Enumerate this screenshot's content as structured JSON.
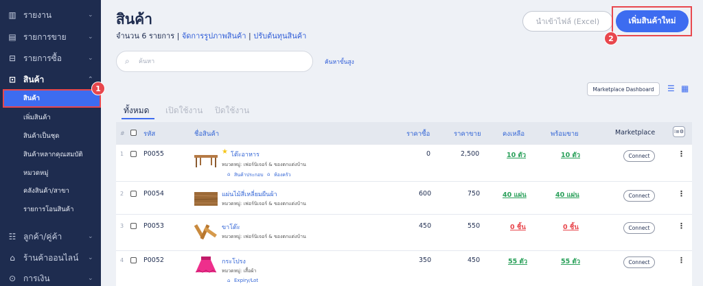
{
  "sidebar": {
    "items_top": [
      {
        "label": "รายงาน",
        "icon": "bar-chart-icon"
      },
      {
        "label": "รายการขาย",
        "icon": "clipboard-icon"
      },
      {
        "label": "รายการซื้อ",
        "icon": "cart-icon"
      },
      {
        "label": "สินค้า",
        "icon": "box-icon"
      }
    ],
    "sub_items": [
      {
        "label": "สินค้า"
      },
      {
        "label": "เพิ่มสินค้า"
      },
      {
        "label": "สินค้าเป็นชุด"
      },
      {
        "label": "สินค้าหลากคุณสมบัติ"
      },
      {
        "label": "หมวดหมู่"
      },
      {
        "label": "คลังสินค้า/สาขา"
      },
      {
        "label": "รายการโอนสินค้า"
      }
    ],
    "items_bottom": [
      {
        "label": "ลูกค้า/คู่ค้า",
        "icon": "people-icon"
      },
      {
        "label": "ร้านค้าออนไลน์",
        "icon": "store-icon"
      },
      {
        "label": "การเงิน",
        "icon": "money-icon"
      }
    ],
    "badge": "1"
  },
  "header": {
    "title": "สินค้า",
    "count_text": "จำนวน 6 รายการ",
    "sep": "|",
    "manage_images_link": "จัดการรูปภาพสินค้า",
    "adjust_cost_link": "ปรับต้นทุนสินค้า",
    "import_button": "นำเข้าไฟล์ (Excel)",
    "add_button": "เพิ่มสินค้าใหม่",
    "badge": "2"
  },
  "search": {
    "placeholder": "ค้นหา",
    "advanced_link": "ค้นหาขั้นสูง"
  },
  "toolbar": {
    "marketplace_dashboard": "Marketplace Dashboard"
  },
  "tabs": [
    {
      "label": "ทั้งหมด",
      "active": true
    },
    {
      "label": "เปิดใช้งาน",
      "active": false
    },
    {
      "label": "ปิดใช้งาน",
      "active": false
    }
  ],
  "table": {
    "headers": {
      "num": "#",
      "code": "รหัส",
      "name": "ชื่อสินค้า",
      "buy_price": "ราคาซื้อ",
      "sell_price": "ราคาขาย",
      "remaining": "คงเหลือ",
      "ready": "พร้อมขาย",
      "marketplace": "Marketplace",
      "columns_button": "⁞≡⚙"
    },
    "rows": [
      {
        "num": "1",
        "code": "P0055",
        "name": "โต๊ะอาหาร",
        "category": "หมวดหมู่: เฟอร์นิเจอร์ & ของตกแต่งบ้าน",
        "tags": [
          "สินค้าประกอบ",
          "ห้องครัว"
        ],
        "starred": true,
        "buy": "0",
        "sell": "2,500",
        "remaining": "10 ตัว",
        "ready": "10 ตัว",
        "stock_color": "#2aa05a",
        "connect": "Connect"
      },
      {
        "num": "2",
        "code": "P0054",
        "name": "แผ่นไม้สี่เหลี่ยมผืนผ้า",
        "category": "หมวดหมู่: เฟอร์นิเจอร์ & ของตกแต่งบ้าน",
        "tags": [],
        "starred": false,
        "buy": "600",
        "sell": "750",
        "remaining": "40 แผ่น",
        "ready": "40 แผ่น",
        "stock_color": "#2aa05a",
        "connect": "Connect"
      },
      {
        "num": "3",
        "code": "P0053",
        "name": "ขาโต๊ะ",
        "category": "หมวดหมู่: เฟอร์นิเจอร์ & ของตกแต่งบ้าน",
        "tags": [],
        "starred": false,
        "buy": "450",
        "sell": "550",
        "remaining": "0 ชิ้น",
        "ready": "0 ชิ้น",
        "stock_color": "#e8474d",
        "connect": "Connect"
      },
      {
        "num": "4",
        "code": "P0052",
        "name": "กระโปรง",
        "category": "หมวดหมู่: เสื้อผ้า",
        "tags": [
          "Expiry/Lot"
        ],
        "starred": false,
        "buy": "350",
        "sell": "450",
        "remaining": "55 ตัว",
        "ready": "55 ตัว",
        "stock_color": "#2aa05a",
        "connect": "Connect"
      }
    ]
  }
}
